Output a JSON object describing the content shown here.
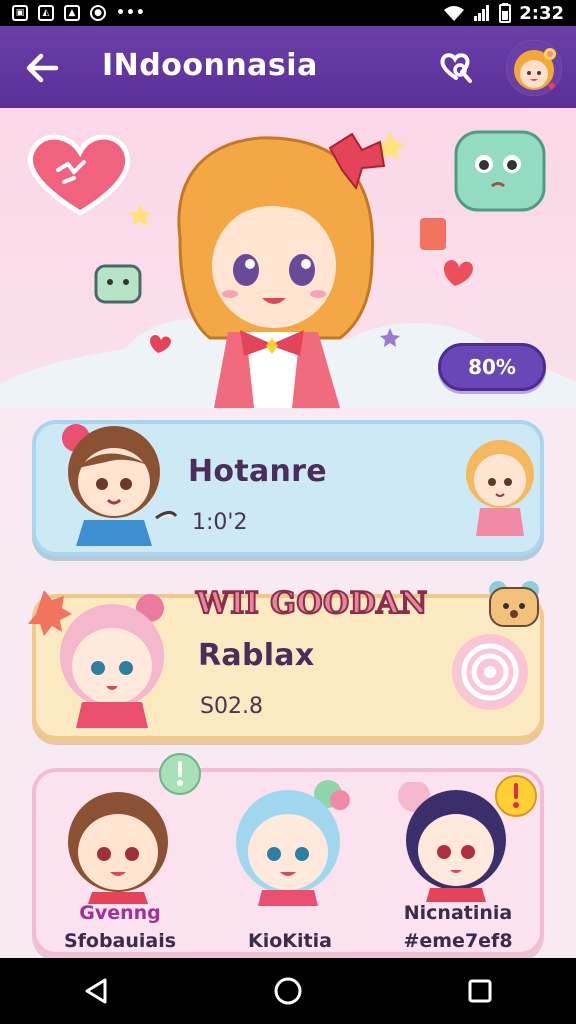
{
  "status_bar": {
    "time": "2:32",
    "left_icons": [
      "notification-icon",
      "image-icon",
      "gallery-icon",
      "circle-app-icon"
    ],
    "right_icons": [
      "wifi-icon",
      "signal-icon",
      "battery-icon"
    ]
  },
  "app_bar": {
    "title": "INdoonnasia",
    "back_icon": "back-arrow-icon",
    "action_icon": "heart-search-icon",
    "avatar": "avatar-girl"
  },
  "hero": {
    "progress_label": "80%",
    "progress_value": 0.8
  },
  "cards": [
    {
      "title": "Hotanre",
      "subtitle": "1:0'2"
    },
    {
      "banner": "WII GOODAN",
      "title": "Rablax",
      "subtitle": "S02.8"
    }
  ],
  "friends": [
    {
      "name_top": "Gvenng",
      "name_bottom": "Sfobauiais"
    },
    {
      "name_top": "",
      "name_bottom": "KioKitia"
    },
    {
      "name_top": "Nicnatinia",
      "name_bottom": "#eme7ef8"
    }
  ],
  "colors": {
    "app_bar": "#5a2f98",
    "accent_purple": "#6a47b6",
    "card_blue": "#cde9f6",
    "card_yellow": "#fbe9c2",
    "card_pink": "#fbe2ee",
    "name_pink": "#a0309a",
    "name_dark": "#3c2c4c"
  },
  "nav_bar": {
    "items": [
      "back-triangle-icon",
      "home-circle-icon",
      "recents-square-icon"
    ]
  }
}
